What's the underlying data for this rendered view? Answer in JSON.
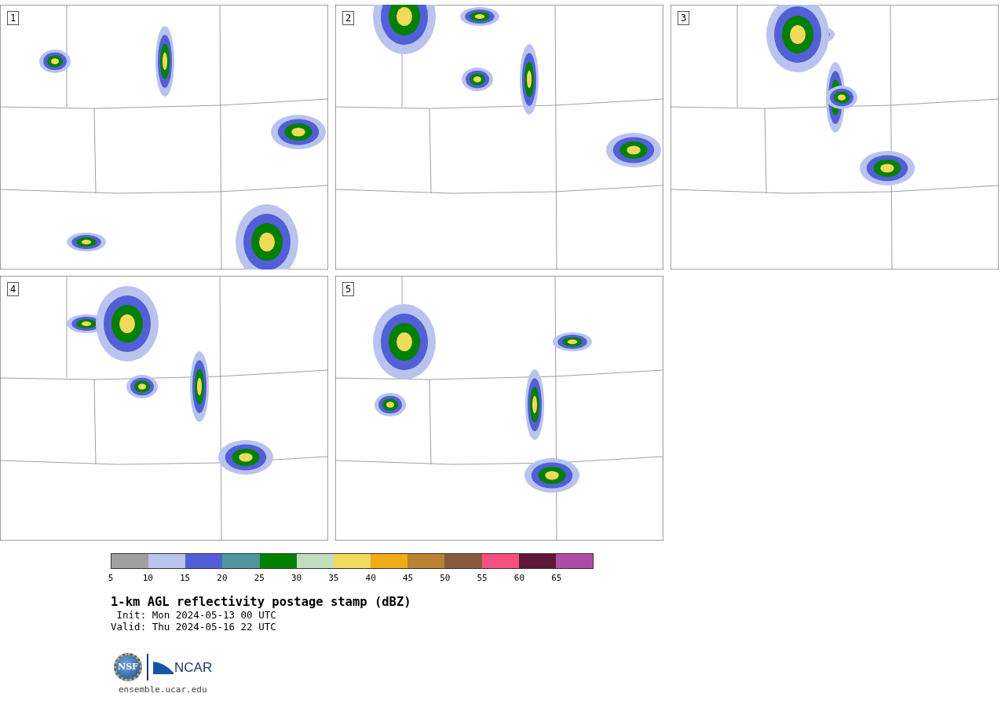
{
  "panels": [
    {
      "label": "1"
    },
    {
      "label": "2"
    },
    {
      "label": "3"
    },
    {
      "label": "4"
    },
    {
      "label": "5"
    }
  ],
  "colorbar": {
    "segments": [
      {
        "color": "#a0a0a0"
      },
      {
        "color": "#b8c4ee"
      },
      {
        "color": "#525fd6"
      },
      {
        "color": "#4e969c"
      },
      {
        "color": "#008000"
      },
      {
        "color": "#bedebe"
      },
      {
        "color": "#f0da5c"
      },
      {
        "color": "#f0ac16"
      },
      {
        "color": "#b88230"
      },
      {
        "color": "#8a5a3e"
      },
      {
        "color": "#f45080"
      },
      {
        "color": "#601636"
      },
      {
        "color": "#ac4ca6"
      }
    ],
    "ticks": [
      "5",
      "10",
      "15",
      "20",
      "25",
      "30",
      "35",
      "40",
      "45",
      "50",
      "55",
      "60",
      "65"
    ]
  },
  "title": "1-km AGL reflectivity postage stamp (dBZ)",
  "init": " Init: Mon 2024-05-13 00 UTC",
  "valid": "Valid: Thu 2024-05-16 22 UTC",
  "logos": {
    "nsf": "NSF",
    "ncar": "NCAR"
  },
  "website": "ensemble.ucar.edu"
}
